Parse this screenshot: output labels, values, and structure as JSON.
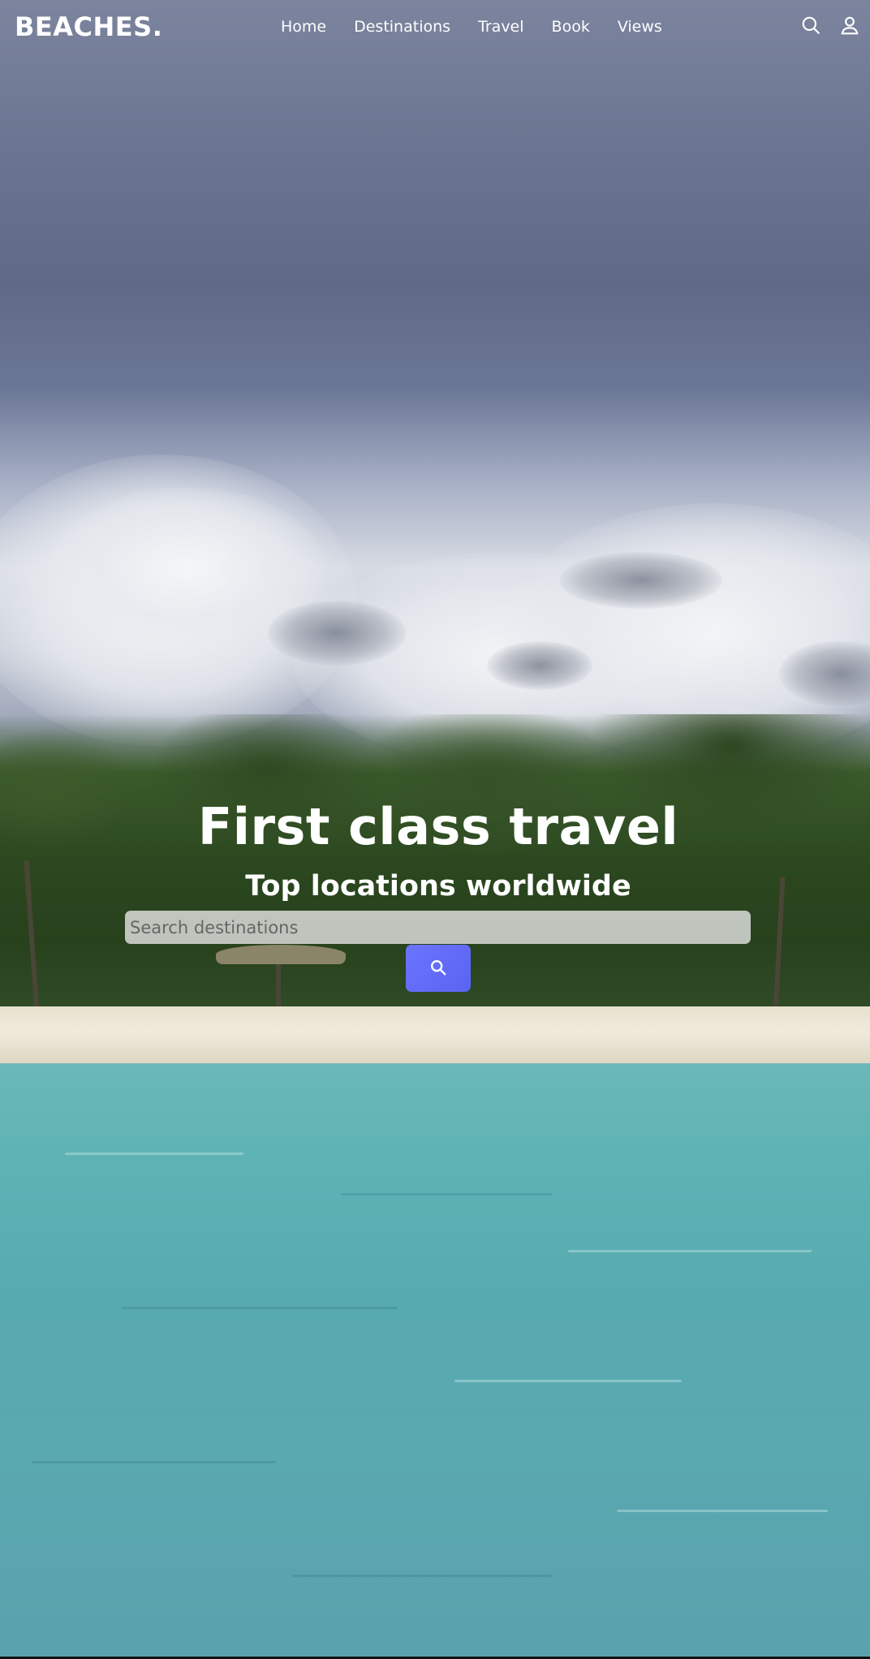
{
  "brand": {
    "logo_text": "BEACHES."
  },
  "nav": {
    "links": [
      {
        "label": "Home"
      },
      {
        "label": "Destinations"
      },
      {
        "label": "Travel"
      },
      {
        "label": "Book"
      },
      {
        "label": "Views"
      }
    ],
    "icons": [
      "search-icon",
      "user-icon"
    ]
  },
  "hero": {
    "title": "First class travel",
    "subtitle": "Top locations worldwide",
    "search": {
      "placeholder": "Search destinations",
      "value": "",
      "button_icon": "search-icon"
    },
    "background": "beach-video-frame"
  },
  "colors": {
    "accent": "#5f69f7",
    "text": "#ffffff"
  }
}
